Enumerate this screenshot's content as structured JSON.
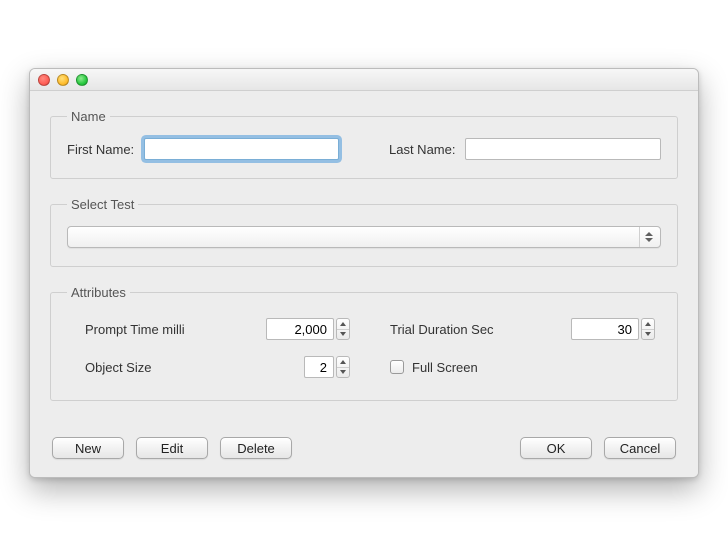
{
  "groups": {
    "name": {
      "legend": "Name",
      "first_label": "First Name:",
      "last_label": "Last Name:",
      "first_value": "",
      "last_value": ""
    },
    "select_test": {
      "legend": "Select Test",
      "selected": ""
    },
    "attributes": {
      "legend": "Attributes",
      "prompt_label": "Prompt Time milli",
      "prompt_value": "2,000",
      "trial_label": "Trial Duration Sec",
      "trial_value": "30",
      "object_size_label": "Object Size",
      "object_size_value": "2",
      "full_screen_label": "Full Screen",
      "full_screen_checked": false
    }
  },
  "buttons": {
    "new": "New",
    "edit": "Edit",
    "delete": "Delete",
    "ok": "OK",
    "cancel": "Cancel"
  }
}
